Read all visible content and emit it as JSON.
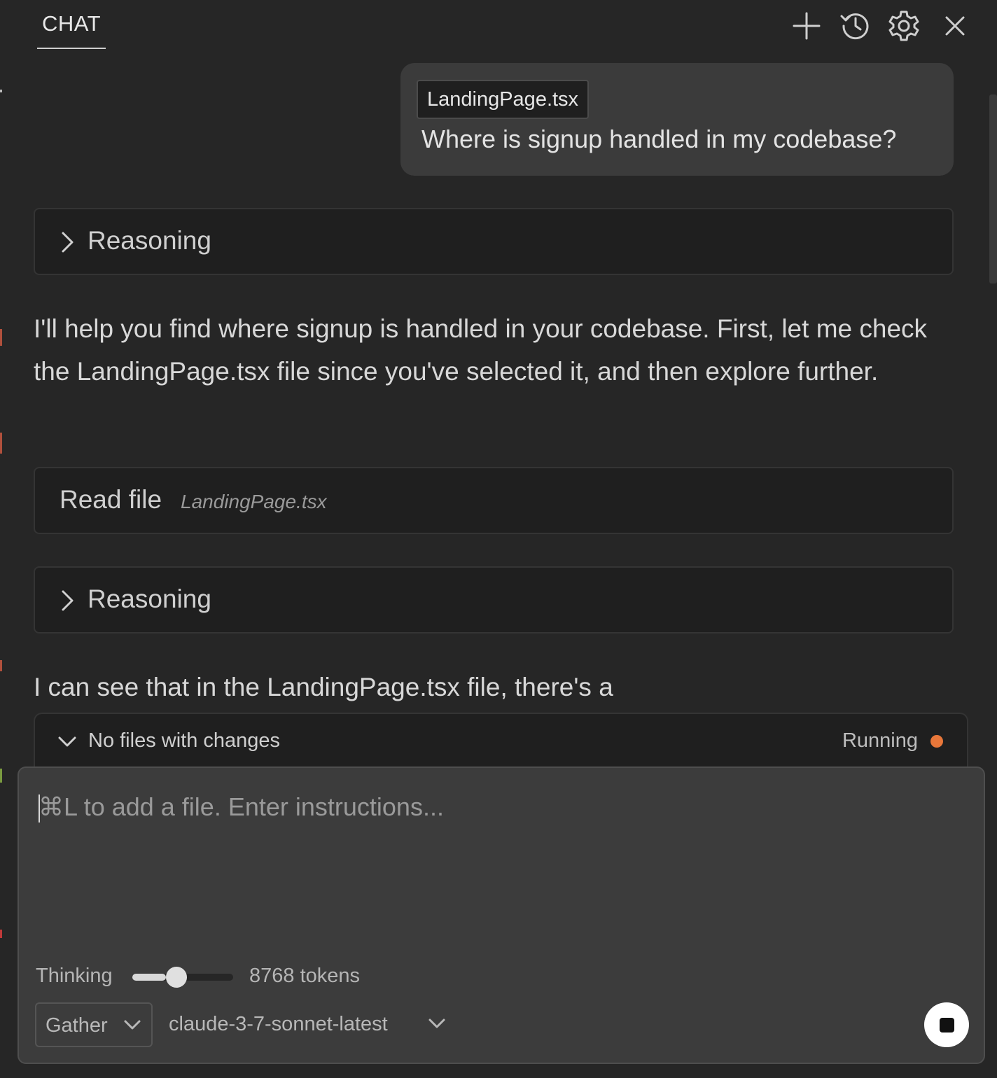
{
  "header": {
    "tab_label": "CHAT",
    "icons": [
      "plus-icon",
      "history-icon",
      "gear-icon",
      "close-icon"
    ]
  },
  "conversation": {
    "user_message": {
      "file_chip": "LandingPage.tsx",
      "text": "Where is signup handled in my codebase?"
    },
    "reasoning_1": {
      "label": "Reasoning",
      "collapsed": true
    },
    "assistant_text_1": "I'll help you find where signup is handled in your codebase. First, let me check the LandingPage.tsx file since you've selected it, and then explore further.",
    "tool_read_file": {
      "label": "Read file",
      "file": "LandingPage.tsx"
    },
    "reasoning_2": {
      "label": "Reasoning",
      "collapsed": true
    },
    "assistant_text_2": "I can see that in the LandingPage.tsx file, there's a"
  },
  "changes_bar": {
    "label": "No files with changes",
    "status": "Running",
    "status_color": "#e8773a"
  },
  "input": {
    "placeholder": "⌘L to add a file. Enter instructions...",
    "thinking": {
      "label": "Thinking",
      "slider_fraction": 0.33,
      "tokens": "8768 tokens"
    },
    "mode": {
      "value": "Gather"
    },
    "model": {
      "value": "claude-3-7-sonnet-latest"
    }
  },
  "colors": {
    "background": "#262626",
    "panel": "#1f1f1f",
    "input_bg": "#3c3c3c",
    "user_bubble": "#3b3b3b",
    "accent_running": "#e8773a"
  }
}
